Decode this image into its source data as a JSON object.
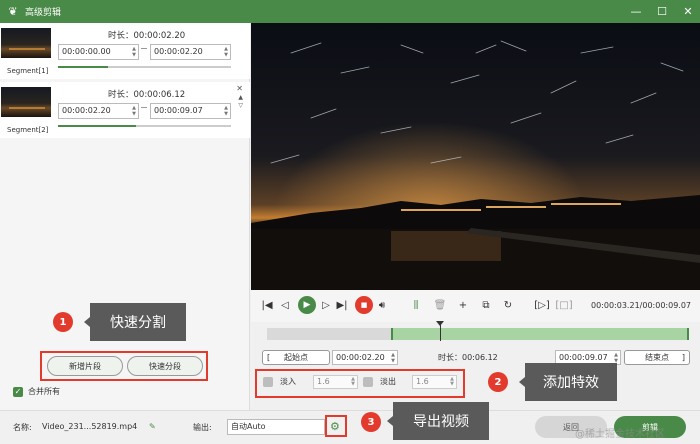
{
  "window": {
    "title": "高级剪辑",
    "logo_icon": "rabbit-logo-icon",
    "minimize": "—",
    "maximize": "☐",
    "close": "✕"
  },
  "segments": [
    {
      "label": "Segment[1]",
      "duration": "时长：00:00:02.20",
      "start": "00:00:00.00",
      "end": "00:00:02.20",
      "progress": 0.29
    },
    {
      "label": "Segment[2]",
      "duration": "时长：00:00:06.12",
      "start": "00:00:02.20",
      "end": "00:00:09.07",
      "progress": 0.45
    }
  ],
  "annotations": {
    "m1": {
      "num": "1",
      "text": "快速分割"
    },
    "m2": {
      "num": "2",
      "text": "添加特效"
    },
    "m3": {
      "num": "3",
      "text": "导出视频"
    }
  },
  "segment_buttons": {
    "add": "新增片段",
    "quick": "快速分段"
  },
  "merge_all": {
    "label": "合并所有",
    "checked": true
  },
  "player": {
    "time": "00:00:03.21/00:00:09.07",
    "timeline": {
      "sel_start": 0.294,
      "sel_end": 1.0,
      "playhead": 0.41
    }
  },
  "trim": {
    "start_label": "起始点",
    "start": "00:00:02.20",
    "duration": "时长：00:06.12",
    "end": "00:00:09.07",
    "end_label": "结束点"
  },
  "effects": {
    "fade_in_label": "淡入",
    "fade_in_value": "1.6",
    "fade_out_label": "淡出",
    "fade_out_value": "1.6"
  },
  "bottom": {
    "name_label": "名称:",
    "name_value": "Video_231...52819.mp4",
    "output_label": "输出:",
    "output_value": "自动Auto",
    "back": "返回",
    "cut": "剪辑"
  },
  "watermark": "@稀土掘金技术社区"
}
